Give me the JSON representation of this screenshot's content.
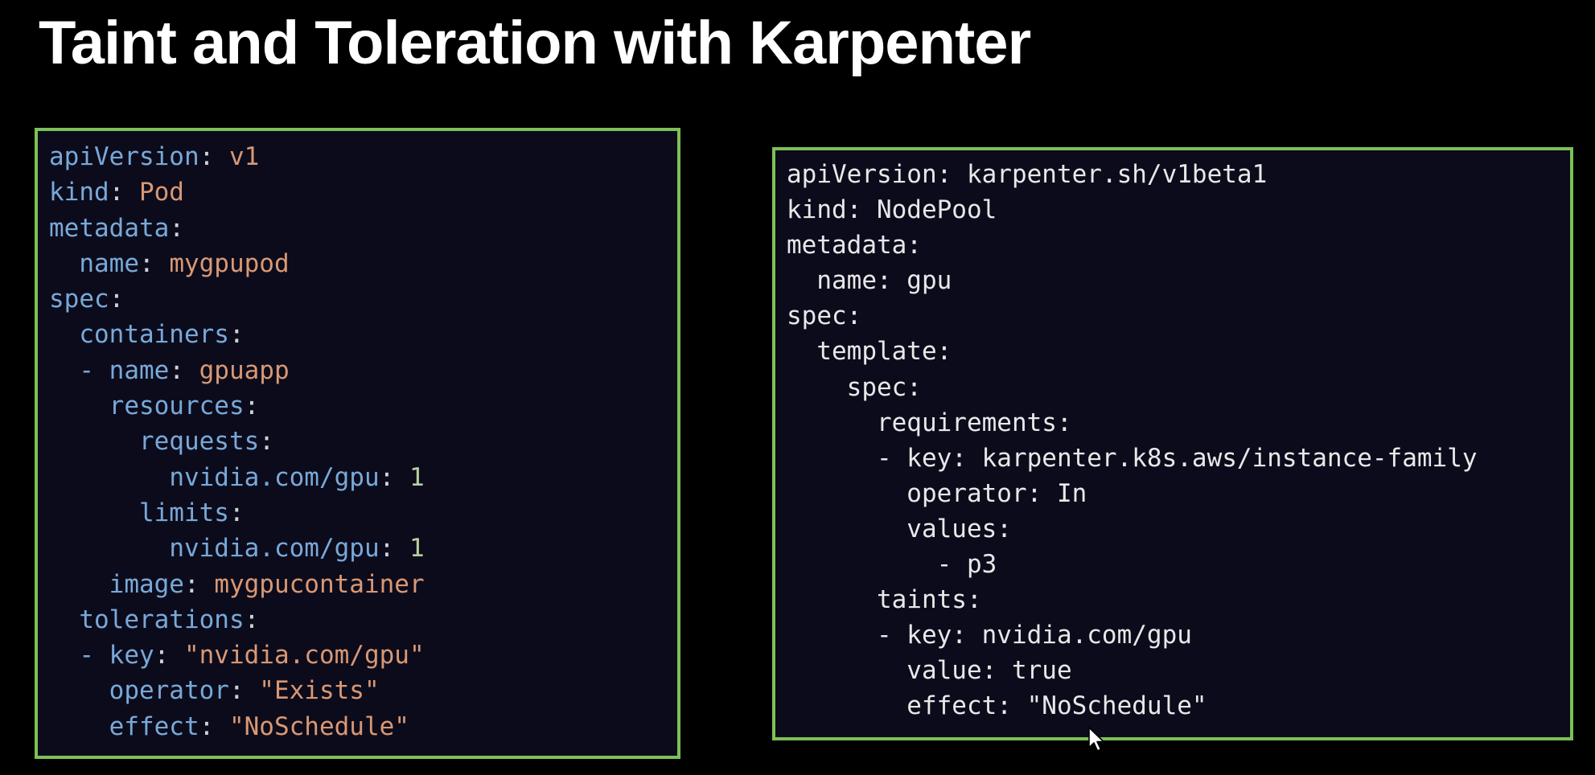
{
  "title": "Taint and Toleration with Karpenter",
  "colors": {
    "background": "#000000",
    "panel_background": "#0c0b1c",
    "panel_border": "#7cc157",
    "yaml_key": "#78a9d8",
    "yaml_string": "#d99873",
    "yaml_number": "#b8cfa0",
    "plain_text": "#e8e8e8"
  },
  "pod_manifest": {
    "lines": [
      {
        "indent": "",
        "dash": "",
        "key": "apiVersion",
        "sep": ": ",
        "value": "v1",
        "type": "v"
      },
      {
        "indent": "",
        "dash": "",
        "key": "kind",
        "sep": ": ",
        "value": "Pod",
        "type": "v"
      },
      {
        "indent": "",
        "dash": "",
        "key": "metadata",
        "sep": ":",
        "value": "",
        "type": "v"
      },
      {
        "indent": "  ",
        "dash": "",
        "key": "name",
        "sep": ": ",
        "value": "mygpupod",
        "type": "v"
      },
      {
        "indent": "",
        "dash": "",
        "key": "spec",
        "sep": ":",
        "value": "",
        "type": "v"
      },
      {
        "indent": "  ",
        "dash": "",
        "key": "containers",
        "sep": ":",
        "value": "",
        "type": "v"
      },
      {
        "indent": "  ",
        "dash": "- ",
        "key": "name",
        "sep": ": ",
        "value": "gpuapp",
        "type": "v"
      },
      {
        "indent": "    ",
        "dash": "",
        "key": "resources",
        "sep": ":",
        "value": "",
        "type": "v"
      },
      {
        "indent": "      ",
        "dash": "",
        "key": "requests",
        "sep": ":",
        "value": "",
        "type": "v"
      },
      {
        "indent": "        ",
        "dash": "",
        "key": "nvidia.com/gpu",
        "sep": ": ",
        "value": "1",
        "type": "n"
      },
      {
        "indent": "      ",
        "dash": "",
        "key": "limits",
        "sep": ":",
        "value": "",
        "type": "v"
      },
      {
        "indent": "        ",
        "dash": "",
        "key": "nvidia.com/gpu",
        "sep": ": ",
        "value": "1",
        "type": "n"
      },
      {
        "indent": "    ",
        "dash": "",
        "key": "image",
        "sep": ": ",
        "value": "mygpucontainer",
        "type": "v"
      },
      {
        "indent": "  ",
        "dash": "",
        "key": "tolerations",
        "sep": ":",
        "value": "",
        "type": "v"
      },
      {
        "indent": "  ",
        "dash": "- ",
        "key": "key",
        "sep": ": ",
        "value": "\"nvidia.com/gpu\"",
        "type": "v"
      },
      {
        "indent": "    ",
        "dash": "",
        "key": "operator",
        "sep": ": ",
        "value": "\"Exists\"",
        "type": "v"
      },
      {
        "indent": "    ",
        "dash": "",
        "key": "effect",
        "sep": ": ",
        "value": "\"NoSchedule\"",
        "type": "v"
      }
    ]
  },
  "nodepool_manifest": {
    "lines": [
      "apiVersion: karpenter.sh/v1beta1",
      "kind: NodePool",
      "metadata:",
      "  name: gpu",
      "spec:",
      "  template:",
      "    spec:",
      "      requirements:",
      "      - key: karpenter.k8s.aws/instance-family",
      "        operator: In",
      "        values:",
      "          - p3",
      "      taints:",
      "      - key: nvidia.com/gpu",
      "        value: true",
      "        effect: \"NoSchedule\""
    ]
  },
  "icons": {
    "cursor": "mouse-pointer-icon"
  }
}
